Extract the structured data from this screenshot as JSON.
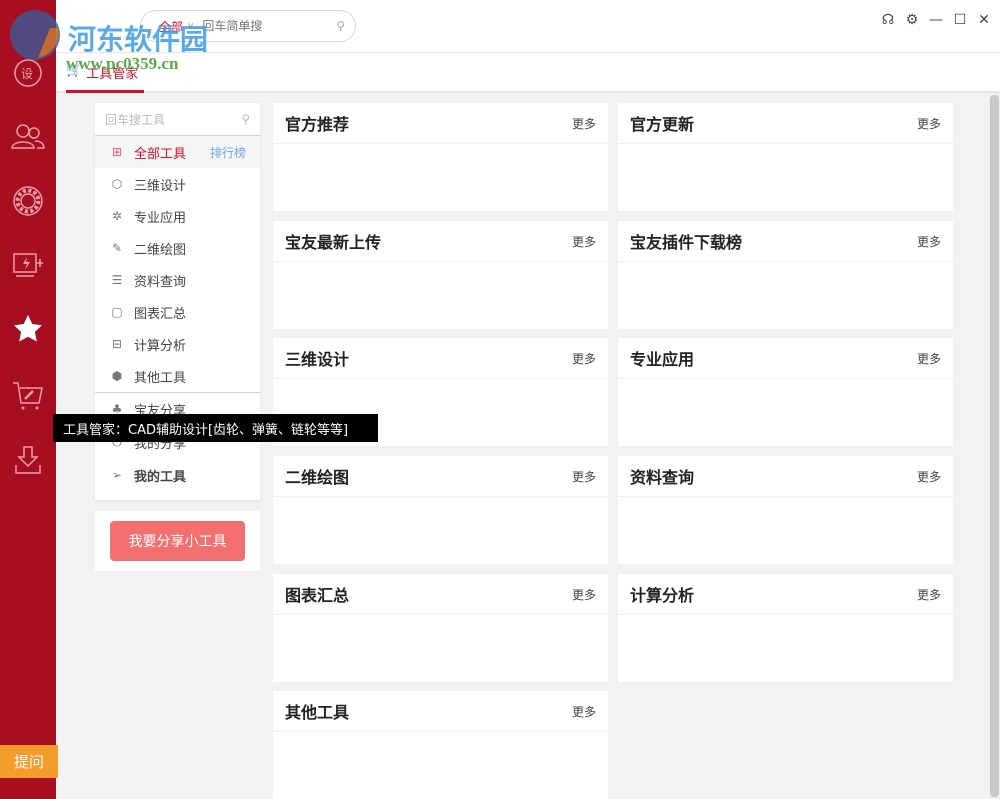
{
  "watermark": {
    "name": "河东软件园",
    "url": "www.pc0359.cn"
  },
  "topbar": {
    "search_scope": "全部",
    "search_placeholder": "回车简单搜"
  },
  "window_icons": [
    "headset-icon",
    "gear-icon",
    "minimize-icon",
    "maximize-icon",
    "close-icon"
  ],
  "tab": {
    "label": "工具管家"
  },
  "rail_icons": [
    "design-icon",
    "users-icon",
    "bearing-icon",
    "motor-icon",
    "star-icon",
    "cart-wrench-icon",
    "download-icon"
  ],
  "panel": {
    "search_placeholder": "回车搜工具",
    "items": [
      {
        "label": "全部工具",
        "icon": "grid-icon",
        "extra": "排行榜"
      },
      {
        "label": "三维设计",
        "icon": "cube-icon"
      },
      {
        "label": "专业应用",
        "icon": "gear-ring-icon"
      },
      {
        "label": "二维绘图",
        "icon": "drafting-icon"
      },
      {
        "label": "资料查询",
        "icon": "database-icon"
      },
      {
        "label": "图表汇总",
        "icon": "chart-doc-icon"
      },
      {
        "label": "计算分析",
        "icon": "calculator-icon"
      },
      {
        "label": "其他工具",
        "icon": "hex-icon"
      }
    ],
    "items2": [
      {
        "label": "宝友分享",
        "icon": "share-icon"
      },
      {
        "label": "我的分享",
        "icon": "upload-icon"
      },
      {
        "label": "我的工具",
        "icon": "send-icon"
      }
    ],
    "share_button": "我要分享小工具"
  },
  "cards": [
    {
      "title": "官方推荐",
      "more": "更多"
    },
    {
      "title": "官方更新",
      "more": "更多"
    },
    {
      "title": "宝友最新上传",
      "more": "更多"
    },
    {
      "title": "宝友插件下载榜",
      "more": "更多"
    },
    {
      "title": "三维设计",
      "more": "更多"
    },
    {
      "title": "专业应用",
      "more": "更多"
    },
    {
      "title": "二维绘图",
      "more": "更多"
    },
    {
      "title": "资料查询",
      "more": "更多"
    },
    {
      "title": "图表汇总",
      "more": "更多"
    },
    {
      "title": "计算分析",
      "more": "更多"
    },
    {
      "title": "其他工具",
      "more": "更多"
    }
  ],
  "tooltip": "工具管家：CAD辅助设计[齿轮、弹簧、链轮等等]",
  "ask_button": "提问",
  "colors": {
    "rail": "#a80e22",
    "accent": "#d0112b",
    "share_button": "#f47070",
    "ask_button": "#f39c2b"
  }
}
